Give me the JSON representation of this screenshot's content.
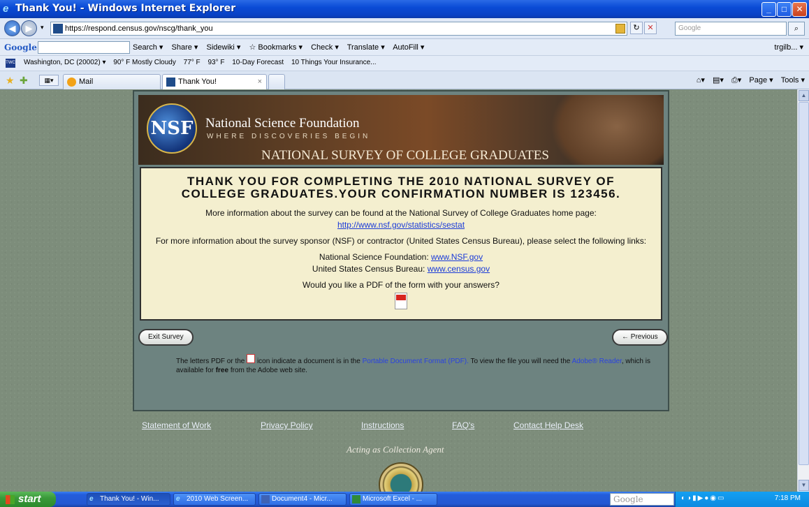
{
  "window": {
    "title": "Thank You! - Windows Internet Explorer",
    "minimize": "_",
    "maximize": "□",
    "close": "✕"
  },
  "address": {
    "url": "https://respond.census.gov/nscg/thank_you",
    "search_placeholder": "Google"
  },
  "google_toolbar": {
    "logo": "Google",
    "items": [
      "Search ▾",
      "Share ▾",
      "Sidewiki ▾",
      "☆ Bookmarks ▾",
      "Check ▾",
      "Translate ▾",
      "AutoFill ▾"
    ],
    "user": "trgilb... ▾"
  },
  "weather_bar": {
    "brand": "TWC",
    "items": [
      "Washington, DC (20002) ▾",
      "90° F Mostly Cloudy",
      "77° F",
      "93° F",
      "10-Day Forecast",
      "10 Things Your Insurance..."
    ]
  },
  "tabs": {
    "mail_label": "Mail",
    "active_label": "Thank You!",
    "close": "×",
    "commands": [
      "Page ▾",
      "Tools ▾"
    ]
  },
  "banner": {
    "logo_text": "NSF",
    "org": "National Science Foundation",
    "tagline": "WHERE DISCOVERIES BEGIN",
    "survey_name": "NATIONAL SURVEY OF COLLEGE GRADUATES"
  },
  "content": {
    "heading": "THANK YOU FOR COMPLETING THE 2010 NATIONAL SURVEY OF COLLEGE GRADUATES.YOUR CONFIRMATION NUMBER IS 123456.",
    "more_info": "More information about the survey can be found at the National Survey of College Graduates home page:",
    "home_link": "http://www.nsf.gov/statistics/sestat",
    "sponsor_info": "For more information about the survey sponsor (NSF) or contractor (United States Census Bureau), please select the following links:",
    "nsf_label": "National Science Foundation:",
    "nsf_link": "www.NSF.gov",
    "census_label": "United States Census Bureau:",
    "census_link": "www.census.gov",
    "pdf_question": "Would you like a PDF of the form with your answers?"
  },
  "buttons": {
    "exit": "Exit Survey",
    "previous": "← Previous"
  },
  "note": {
    "part1": "The letters PDF or the",
    "part2": "icon indicate a document is in the",
    "pdf_link": "Portable Document Format (PDF).",
    "part3": "To view the file you will need the",
    "reader_link": "Adobe® Reader",
    "part4": ", which is available for",
    "free": "free",
    "part5": "from the Adobe web site."
  },
  "footer": {
    "links": [
      "Statement of Work",
      "Privacy Policy",
      "Instructions",
      "FAQ's",
      "Contact Help Desk"
    ],
    "collection": "Acting as Collection Agent"
  },
  "taskbar": {
    "start": "start",
    "items": [
      "Thank You! - Win...",
      "2010 Web Screen...",
      "Document4 - Micr...",
      "Microsoft Excel - ..."
    ],
    "google": "Google",
    "clock": "7:18 PM"
  }
}
